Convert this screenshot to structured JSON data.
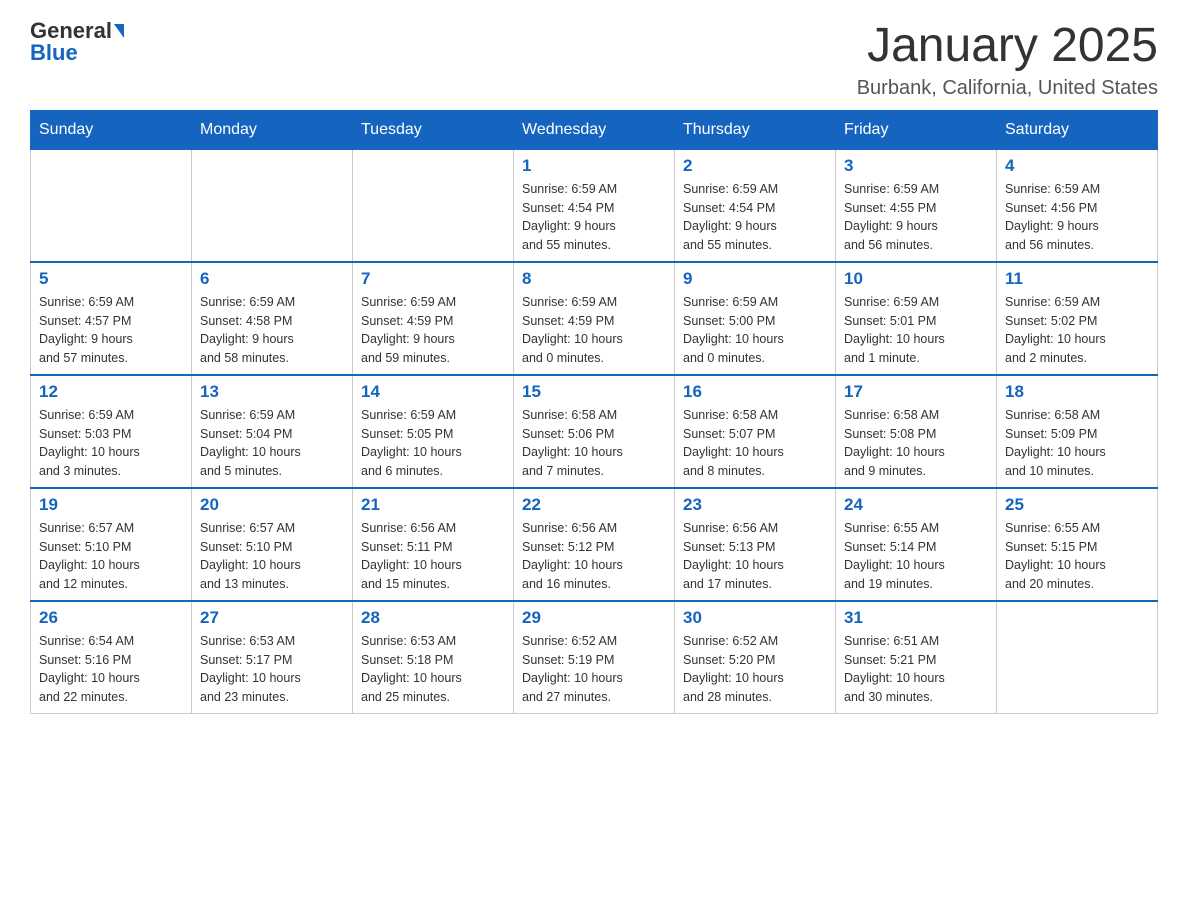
{
  "header": {
    "logo_general": "General",
    "logo_blue": "Blue",
    "month_title": "January 2025",
    "location": "Burbank, California, United States"
  },
  "days_of_week": [
    "Sunday",
    "Monday",
    "Tuesday",
    "Wednesday",
    "Thursday",
    "Friday",
    "Saturday"
  ],
  "weeks": [
    [
      {
        "day": "",
        "info": ""
      },
      {
        "day": "",
        "info": ""
      },
      {
        "day": "",
        "info": ""
      },
      {
        "day": "1",
        "info": "Sunrise: 6:59 AM\nSunset: 4:54 PM\nDaylight: 9 hours\nand 55 minutes."
      },
      {
        "day": "2",
        "info": "Sunrise: 6:59 AM\nSunset: 4:54 PM\nDaylight: 9 hours\nand 55 minutes."
      },
      {
        "day": "3",
        "info": "Sunrise: 6:59 AM\nSunset: 4:55 PM\nDaylight: 9 hours\nand 56 minutes."
      },
      {
        "day": "4",
        "info": "Sunrise: 6:59 AM\nSunset: 4:56 PM\nDaylight: 9 hours\nand 56 minutes."
      }
    ],
    [
      {
        "day": "5",
        "info": "Sunrise: 6:59 AM\nSunset: 4:57 PM\nDaylight: 9 hours\nand 57 minutes."
      },
      {
        "day": "6",
        "info": "Sunrise: 6:59 AM\nSunset: 4:58 PM\nDaylight: 9 hours\nand 58 minutes."
      },
      {
        "day": "7",
        "info": "Sunrise: 6:59 AM\nSunset: 4:59 PM\nDaylight: 9 hours\nand 59 minutes."
      },
      {
        "day": "8",
        "info": "Sunrise: 6:59 AM\nSunset: 4:59 PM\nDaylight: 10 hours\nand 0 minutes."
      },
      {
        "day": "9",
        "info": "Sunrise: 6:59 AM\nSunset: 5:00 PM\nDaylight: 10 hours\nand 0 minutes."
      },
      {
        "day": "10",
        "info": "Sunrise: 6:59 AM\nSunset: 5:01 PM\nDaylight: 10 hours\nand 1 minute."
      },
      {
        "day": "11",
        "info": "Sunrise: 6:59 AM\nSunset: 5:02 PM\nDaylight: 10 hours\nand 2 minutes."
      }
    ],
    [
      {
        "day": "12",
        "info": "Sunrise: 6:59 AM\nSunset: 5:03 PM\nDaylight: 10 hours\nand 3 minutes."
      },
      {
        "day": "13",
        "info": "Sunrise: 6:59 AM\nSunset: 5:04 PM\nDaylight: 10 hours\nand 5 minutes."
      },
      {
        "day": "14",
        "info": "Sunrise: 6:59 AM\nSunset: 5:05 PM\nDaylight: 10 hours\nand 6 minutes."
      },
      {
        "day": "15",
        "info": "Sunrise: 6:58 AM\nSunset: 5:06 PM\nDaylight: 10 hours\nand 7 minutes."
      },
      {
        "day": "16",
        "info": "Sunrise: 6:58 AM\nSunset: 5:07 PM\nDaylight: 10 hours\nand 8 minutes."
      },
      {
        "day": "17",
        "info": "Sunrise: 6:58 AM\nSunset: 5:08 PM\nDaylight: 10 hours\nand 9 minutes."
      },
      {
        "day": "18",
        "info": "Sunrise: 6:58 AM\nSunset: 5:09 PM\nDaylight: 10 hours\nand 10 minutes."
      }
    ],
    [
      {
        "day": "19",
        "info": "Sunrise: 6:57 AM\nSunset: 5:10 PM\nDaylight: 10 hours\nand 12 minutes."
      },
      {
        "day": "20",
        "info": "Sunrise: 6:57 AM\nSunset: 5:10 PM\nDaylight: 10 hours\nand 13 minutes."
      },
      {
        "day": "21",
        "info": "Sunrise: 6:56 AM\nSunset: 5:11 PM\nDaylight: 10 hours\nand 15 minutes."
      },
      {
        "day": "22",
        "info": "Sunrise: 6:56 AM\nSunset: 5:12 PM\nDaylight: 10 hours\nand 16 minutes."
      },
      {
        "day": "23",
        "info": "Sunrise: 6:56 AM\nSunset: 5:13 PM\nDaylight: 10 hours\nand 17 minutes."
      },
      {
        "day": "24",
        "info": "Sunrise: 6:55 AM\nSunset: 5:14 PM\nDaylight: 10 hours\nand 19 minutes."
      },
      {
        "day": "25",
        "info": "Sunrise: 6:55 AM\nSunset: 5:15 PM\nDaylight: 10 hours\nand 20 minutes."
      }
    ],
    [
      {
        "day": "26",
        "info": "Sunrise: 6:54 AM\nSunset: 5:16 PM\nDaylight: 10 hours\nand 22 minutes."
      },
      {
        "day": "27",
        "info": "Sunrise: 6:53 AM\nSunset: 5:17 PM\nDaylight: 10 hours\nand 23 minutes."
      },
      {
        "day": "28",
        "info": "Sunrise: 6:53 AM\nSunset: 5:18 PM\nDaylight: 10 hours\nand 25 minutes."
      },
      {
        "day": "29",
        "info": "Sunrise: 6:52 AM\nSunset: 5:19 PM\nDaylight: 10 hours\nand 27 minutes."
      },
      {
        "day": "30",
        "info": "Sunrise: 6:52 AM\nSunset: 5:20 PM\nDaylight: 10 hours\nand 28 minutes."
      },
      {
        "day": "31",
        "info": "Sunrise: 6:51 AM\nSunset: 5:21 PM\nDaylight: 10 hours\nand 30 minutes."
      },
      {
        "day": "",
        "info": ""
      }
    ]
  ]
}
